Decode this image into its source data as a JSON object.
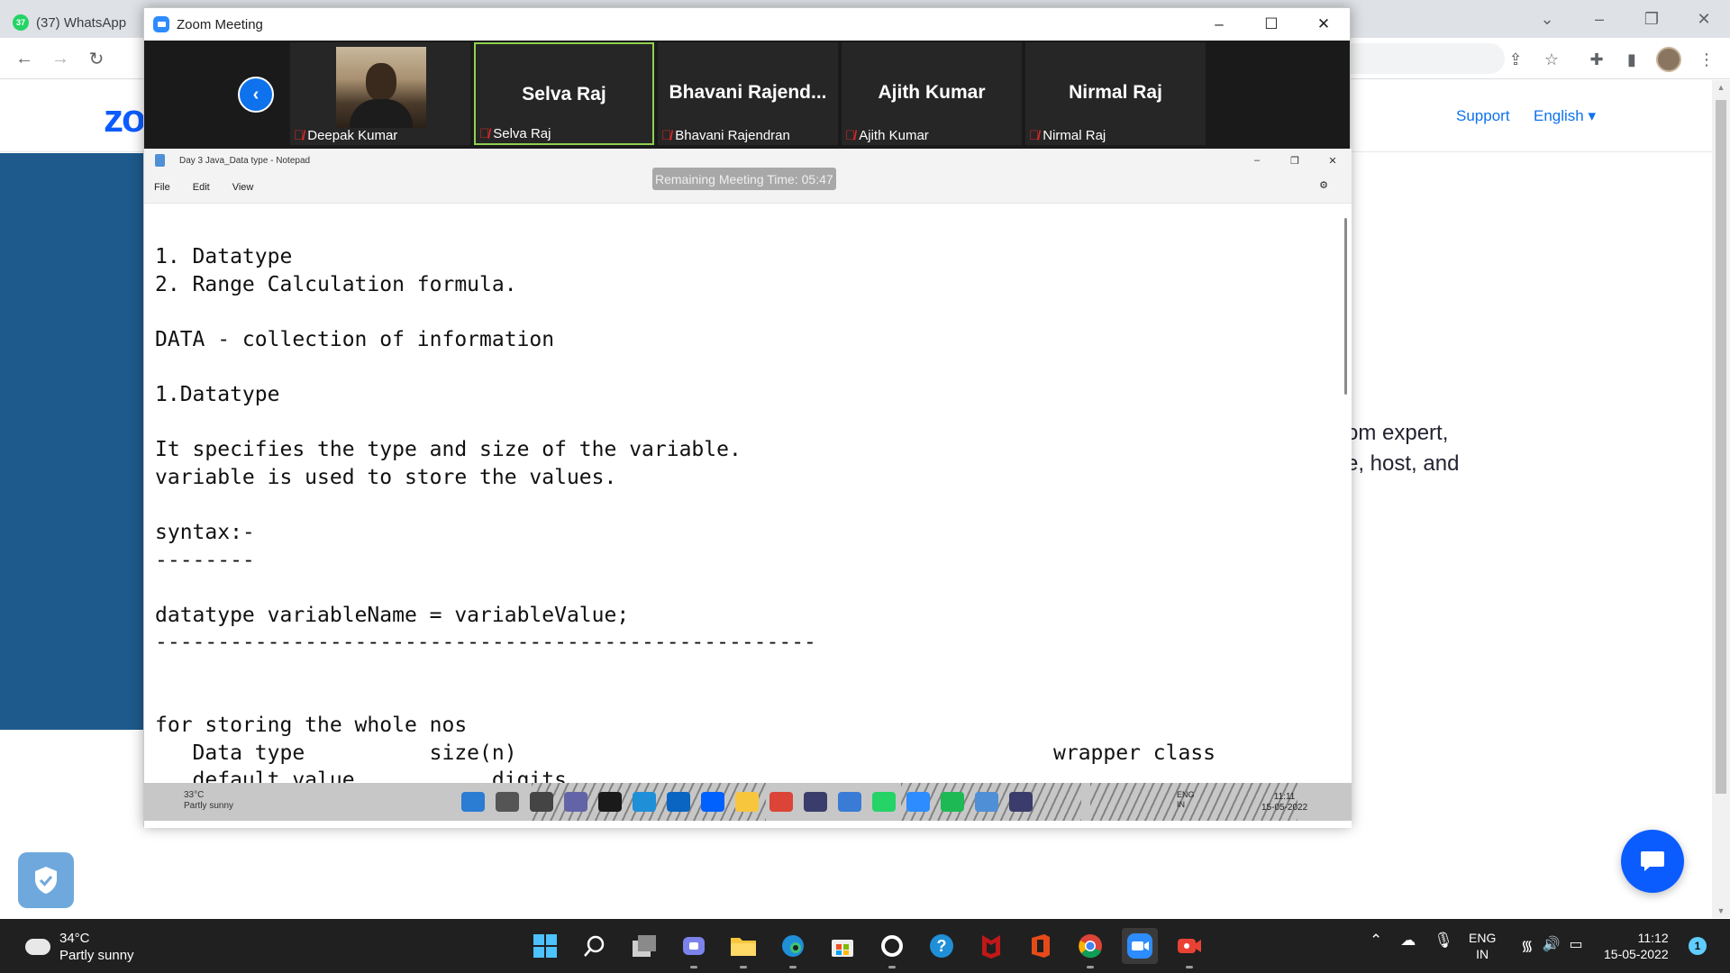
{
  "chrome": {
    "tab_title": "(37) WhatsApp",
    "tab_badge": "37",
    "back_icon": "←",
    "forward_icon": "→",
    "reload_icon": "↻"
  },
  "site": {
    "logo": "zo",
    "support": "Support",
    "language": "English ▾",
    "hero_line1": "om expert,",
    "hero_line2": "e, host, and"
  },
  "zoom": {
    "window_title": "Zoom Meeting",
    "minimize": "–",
    "maximize": "☐",
    "close": "✕",
    "prev_arrow": "‹",
    "participants": [
      {
        "name": "Deepak Kumar",
        "label": "Deepak Kumar",
        "video": true
      },
      {
        "name": "Selva Raj",
        "label": "Selva Raj",
        "video": false,
        "active": true
      },
      {
        "name": "Bhavani  Rajend...",
        "label": "Bhavani Rajendran",
        "video": false
      },
      {
        "name": "Ajith Kumar",
        "label": "Ajith Kumar",
        "video": false
      },
      {
        "name": "Nirmal Raj",
        "label": "Nirmal Raj",
        "video": false
      }
    ],
    "remaining_time": "Remaining Meeting Time: 05:47"
  },
  "notepad": {
    "title": "Day 3 Java_Data type - Notepad",
    "menu": [
      "File",
      "Edit",
      "View"
    ],
    "content": "1. Datatype\n2. Range Calculation formula.\n\nDATA - collection of information\n\n1.Datatype\n\nIt specifies the type and size of the variable.\nvariable is used to store the values.\n\nsyntax:-\n--------\n\ndatatype variableName = variableValue;\n-----------------------------------------------------\n\n\nfor storing the whole nos\n   Data type          size(n)                                           wrapper class\n   default value           digits"
  },
  "remote_taskbar": {
    "temp": "33°C",
    "condition": "Partly sunny",
    "lang1": "ENG",
    "lang2": "IN",
    "time": "11:11",
    "date": "15-05-2022"
  },
  "taskbar": {
    "temp": "34°C",
    "condition": "Partly sunny",
    "lang1": "ENG",
    "lang2": "IN",
    "time": "11:12",
    "date": "15-05-2022",
    "notifications": "1"
  },
  "colors": {
    "zoom_blue": "#0b5cff",
    "active_speaker": "#8fd14f",
    "muted_red": "#e02828"
  }
}
